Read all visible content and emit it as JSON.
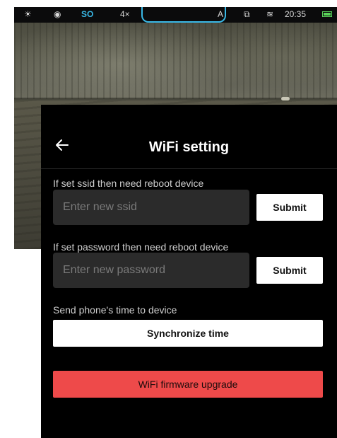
{
  "status_bar": {
    "icons": [
      "sun-icon",
      "eye-icon",
      "wifi-icon",
      "battery-icon"
    ],
    "mode": "SO",
    "zoom": "4×",
    "auto": "A",
    "time": "20:35",
    "accent": "#39b8e6",
    "battery_color": "#5ad45a"
  },
  "header": {
    "title": "WiFi setting",
    "back_icon": "arrow-left-icon"
  },
  "ssid_section": {
    "label": "If set ssid then need reboot device",
    "placeholder": "Enter new ssid",
    "value": "",
    "submit_label": "Submit"
  },
  "password_section": {
    "label": "If set password then need reboot device",
    "placeholder": "Enter new password",
    "value": "",
    "submit_label": "Submit"
  },
  "time_section": {
    "label": "Send phone's time to device",
    "button_label": "Synchronize time"
  },
  "firmware": {
    "button_label": "WiFi firmware upgrade",
    "button_color": "#ee4a4a"
  }
}
